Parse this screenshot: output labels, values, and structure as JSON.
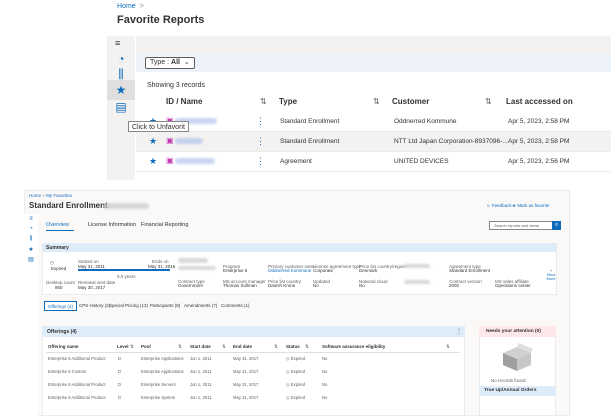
{
  "top": {
    "breadcrumb": "Home",
    "breadcrumb_sep": ">",
    "title": "Favorite Reports",
    "filter_chip_label": "Type : ",
    "filter_chip_value": "All",
    "record_count": "Showing 3 records",
    "columns": [
      "ID / Name",
      "Type",
      "Customer",
      "Last accessed on"
    ],
    "tooltip": "Click to Unfavorit",
    "rows": [
      {
        "type": "Standard Enrollment",
        "customer": "Oddnerred Kommune",
        "accessed": "Apr 5, 2023, 2:58 PM"
      },
      {
        "type": "Standard Enrollment",
        "customer": "NTT Ltd Japan Corporation-8937096-...",
        "accessed": "Apr 5, 2023, 2:58 PM"
      },
      {
        "type": "Agreement",
        "customer": "UNITED DEVICES",
        "accessed": "Apr 5, 2023, 2:56 PM"
      }
    ],
    "accent": "#0f6cbd"
  },
  "bottom": {
    "breadcrumb_home": "Home",
    "breadcrumb_sep": ">",
    "breadcrumb_fav": "My Favorites",
    "title": "Standard Enrollment",
    "feedback": "Feedback",
    "mark_favorite": "Mark as favorite",
    "search_placeholder": "Search reports and views",
    "tabs": [
      "Overview",
      "License Information",
      "Financial Reporting"
    ],
    "summary": {
      "heading": "Summary",
      "status": "Expired",
      "started_label": "Started on",
      "started": "May 31, 2011",
      "ends_label": "Ends on",
      "ends": "May 31, 2016",
      "years": "5.0 years",
      "renewal_label": "Renewal sent date",
      "renewal": "May 30, 2017",
      "desktop_label": "Desktop count",
      "desktop": "850",
      "program_label": "Program",
      "program": "Enterprise 6",
      "contract_label": "Contract type",
      "contract": "Government",
      "primary_label": "Primary customer name",
      "primary": "Oddnerred Kommune",
      "ms_mgr_label": "MS account manager",
      "ms_mgr": "Thomas Sollman",
      "lic_label": "License agreement type",
      "lic": "Corporate",
      "price_label": "Price list country",
      "price": "Danish Krone",
      "updated_label": "Updated",
      "updated": "No",
      "plc_label": "Price list country/region",
      "plc": "Denmark",
      "natl_label": "National cloud",
      "natl": "No",
      "agr_label": "Agreement type",
      "agr": "Standard Enrollment",
      "cs_label": "Contract version",
      "cs": "2000",
      "ops_label": "MS sales affiliate",
      "ops": "Operations center",
      "view_more": "View More"
    },
    "subtabs": [
      "Offerings (4)",
      "CPS History (2)",
      "Special Pricing (13)",
      "Participants (8)",
      "Amendments (7)",
      "Comments (1)"
    ],
    "offerings": {
      "heading": "Offerings (4)",
      "columns": [
        "Offering name",
        "Level",
        "Pool",
        "Start date",
        "End date",
        "Status",
        "Software assurance eligibility"
      ],
      "rows": [
        [
          "Enterprise 6 Additional Product",
          "D",
          "Enterprise Applications",
          "Jun 1, 2011",
          "May 31, 2017",
          "Expired",
          "No"
        ],
        [
          "Enterprise 6 Custom",
          "D",
          "Enterprise Applications",
          "Jun 1, 2011",
          "May 31, 2017",
          "Expired",
          "No"
        ],
        [
          "Enterprise 6 Additional Product",
          "D",
          "Enterprise Servers",
          "Jun 1, 2011",
          "May 31, 2017",
          "Expired",
          "No"
        ],
        [
          "Enterprise 6 Additional Product",
          "D",
          "Enterprise System",
          "Jun 1, 2011",
          "May 31, 2017",
          "Expired",
          "No"
        ]
      ]
    },
    "attention": {
      "heading": "Needs your attention (0)",
      "empty": "No records found",
      "footer": "True Up/Annual Orders"
    }
  }
}
